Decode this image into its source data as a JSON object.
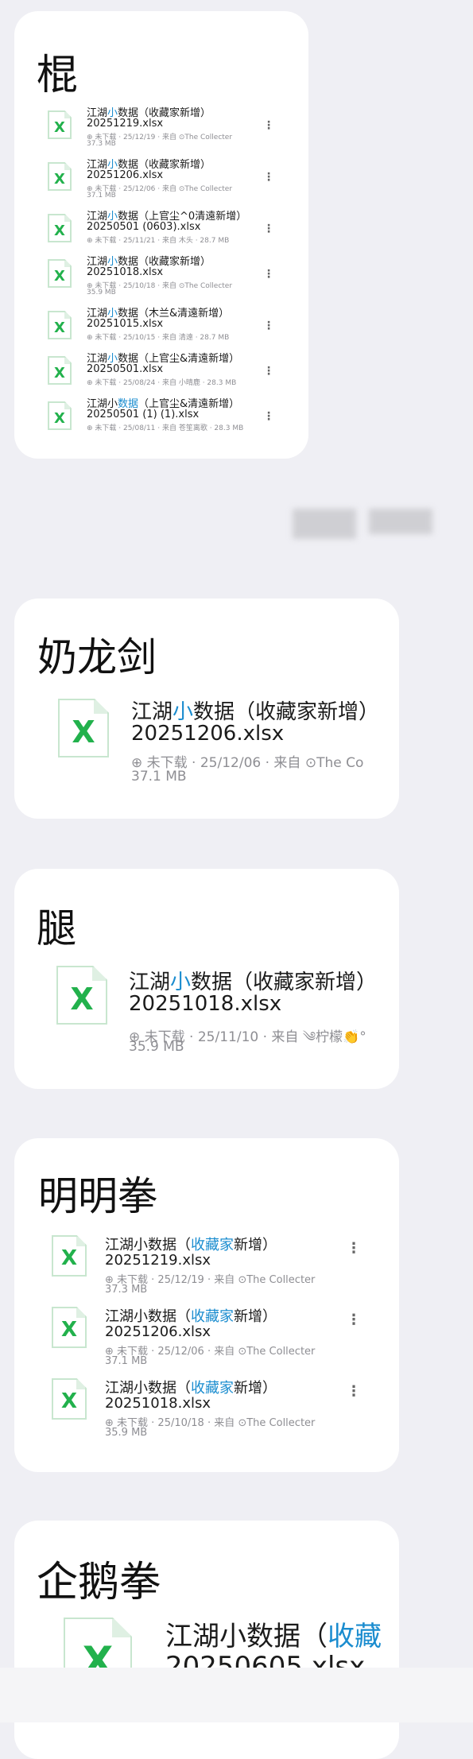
{
  "colors": {
    "background": "#efeff4",
    "card": "#ffffff",
    "excel_green": "#22b14c",
    "highlight": "#1a8ccf",
    "meta": "#8e8e93"
  },
  "cards": [
    {
      "title": "棍",
      "files": [
        {
          "name_pre": "江湖",
          "name_hl": "小",
          "name_post": "数据（收藏家新增）",
          "file": "20251219.xlsx",
          "meta": "⊕ 未下载 · 25/12/19 · 来自 ⊙The Collecter",
          "size": "37.3 MB",
          "more": "⋮"
        },
        {
          "name_pre": "江湖",
          "name_hl": "小",
          "name_post": "数据（收藏家新增）",
          "file": "20251206.xlsx",
          "meta": "⊕ 未下载 · 25/12/06 · 来自 ⊙The Collecter",
          "size": "37.1 MB",
          "more": "⋮"
        },
        {
          "name_pre": "江湖",
          "name_hl": "小",
          "name_post": "数据（上官尘^0清遠新增）",
          "file": "20250501 (0603).xlsx",
          "meta": "⊕ 未下载 · 25/11/21 · 来自 木头 · 28.7 MB",
          "size": "",
          "more": "⋮"
        },
        {
          "name_pre": "江湖",
          "name_hl": "小",
          "name_post": "数据（收藏家新增）",
          "file": "20251018.xlsx",
          "meta": "⊕ 未下载 · 25/10/18 · 来自 ⊙The Collecter",
          "size": "35.9 MB",
          "more": "⋮"
        },
        {
          "name_pre": "江湖",
          "name_hl": "小",
          "name_post": "数据（木兰&清遠新增）",
          "file": "20251015.xlsx",
          "meta": "⊕ 未下载 · 25/10/15 · 来自 清遠 · 28.7 MB",
          "size": "",
          "more": "⋮"
        },
        {
          "name_pre": "江湖",
          "name_hl": "小",
          "name_post": "数据（上官尘&清遠新增）",
          "file": "20250501.xlsx",
          "meta": "⊕ 未下载 · 25/08/24 · 来自 小晴鹿 · 28.3 MB",
          "size": "",
          "more": "⋮"
        },
        {
          "name_pre": "江湖小",
          "name_hl": "数据",
          "name_post": "（上官尘&清遠新增）",
          "file": "20250501 (1) (1).xlsx",
          "meta": "⊕ 未下载 · 25/08/11 · 来自 苍笙离歌 · 28.3 MB",
          "size": "",
          "more": "⋮"
        }
      ]
    },
    {
      "title": "奶龙剑",
      "files": [
        {
          "name_pre": "江湖",
          "name_hl": "小",
          "name_post": "数据（收藏家新增）",
          "file": "20251206.xlsx",
          "meta": "⊕ 未下载 · 25/12/06 · 来自 ⊙The Co",
          "size": "37.1 MB",
          "more": ""
        }
      ]
    },
    {
      "title": "腿",
      "files": [
        {
          "name_pre": "江湖",
          "name_hl": "小",
          "name_post": "数据（收藏家新增）",
          "file": "20251018.xlsx",
          "meta": "⊕ 未下载 · 25/11/10 · 来自 ༄柠檬👏°",
          "size": "35.9 MB",
          "more": ""
        }
      ]
    },
    {
      "title": "明明拳",
      "files": [
        {
          "name_pre": "江湖小数据（",
          "name_hl": "收藏家",
          "name_post": "新增）",
          "file": "20251219.xlsx",
          "meta": "⊕ 未下载 · 25/12/19 · 来自 ⊙The Collecter",
          "size": "37.3 MB",
          "more": "⋮"
        },
        {
          "name_pre": "江湖小数据（",
          "name_hl": "收藏家",
          "name_post": "新增）",
          "file": "20251206.xlsx",
          "meta": "⊕ 未下载 · 25/12/06 · 来自 ⊙The Collecter",
          "size": "37.1 MB",
          "more": "⋮"
        },
        {
          "name_pre": "江湖小数据（",
          "name_hl": "收藏家",
          "name_post": "新增）",
          "file": "20251018.xlsx",
          "meta": "⊕ 未下载 · 25/10/18 · 来自 ⊙The Collecter",
          "size": "35.9 MB",
          "more": "⋮"
        }
      ]
    },
    {
      "title": "企鹅拳",
      "files": [
        {
          "name_pre": "江湖小数据（",
          "name_hl": "收藏",
          "name_post": "",
          "file": "20250605.xlsx",
          "meta": "",
          "size": "",
          "more": ""
        }
      ]
    }
  ]
}
